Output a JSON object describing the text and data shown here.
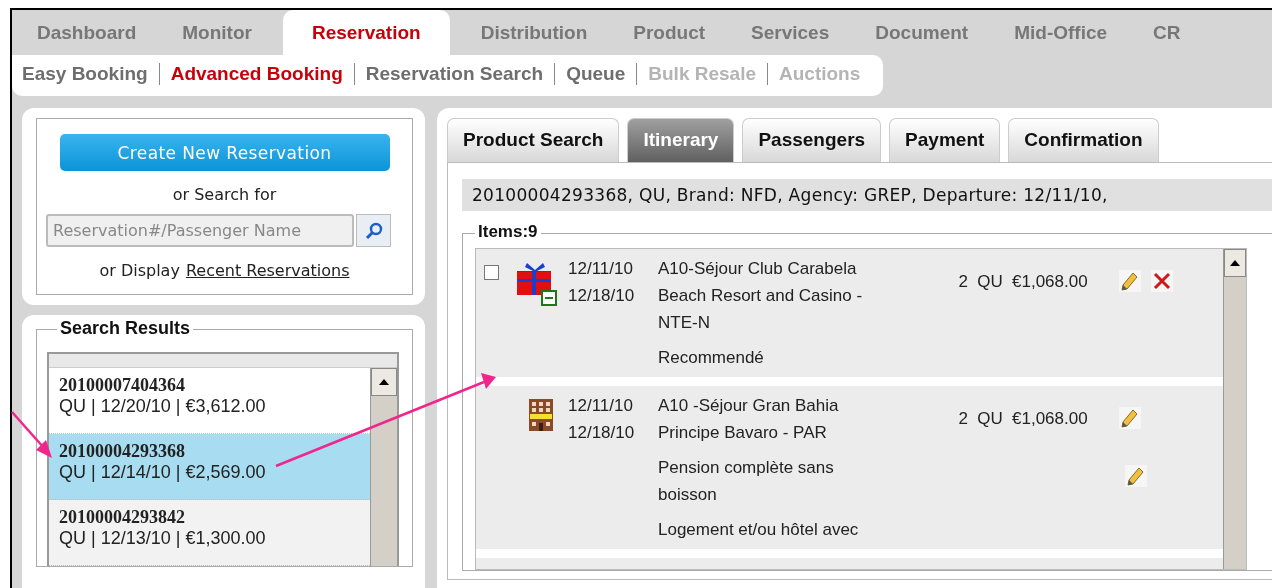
{
  "main_tabs": [
    {
      "label": "Dashboard",
      "selected": false
    },
    {
      "label": "Monitor",
      "selected": false
    },
    {
      "label": "Reservation",
      "selected": true
    },
    {
      "label": "Distribution",
      "selected": false
    },
    {
      "label": "Product",
      "selected": false
    },
    {
      "label": "Services",
      "selected": false
    },
    {
      "label": "Document",
      "selected": false
    },
    {
      "label": "Mid-Office",
      "selected": false
    },
    {
      "label": "CR",
      "selected": false
    }
  ],
  "sub_nav": [
    {
      "label": "Easy Booking",
      "selected": false,
      "disabled": false
    },
    {
      "label": "Advanced Booking",
      "selected": true,
      "disabled": false
    },
    {
      "label": "Reservation Search",
      "selected": false,
      "disabled": false
    },
    {
      "label": "Queue",
      "selected": false,
      "disabled": false
    },
    {
      "label": "Bulk Resale",
      "selected": false,
      "disabled": true
    },
    {
      "label": "Auctions",
      "selected": false,
      "disabled": true
    }
  ],
  "search_panel": {
    "create_button": "Create New Reservation",
    "search_prompt": "or Search for",
    "search_field": {
      "placeholder": "Reservation#/Passenger Name"
    },
    "display_prompt": "or Display",
    "recent_link": "Recent Reservations"
  },
  "search_results": {
    "title": "Search Results",
    "rows": [
      {
        "number": "20100007404364",
        "details": "QU | 12/20/10 | €3,612.00",
        "selected": false
      },
      {
        "number": "20100004293368",
        "details": "QU | 12/14/10 | €2,569.00",
        "selected": true
      },
      {
        "number": "20100004293842",
        "details": "QU | 12/13/10 | €1,300.00",
        "selected": false
      }
    ]
  },
  "booking_tabs": [
    {
      "label": "Product Search",
      "selected": false
    },
    {
      "label": "Itinerary",
      "selected": true
    },
    {
      "label": "Passengers",
      "selected": false
    },
    {
      "label": "Payment",
      "selected": false
    },
    {
      "label": "Confirmation",
      "selected": false
    }
  ],
  "summary": "20100004293368, QU, Brand: NFD, Agency: GREP, Departure: 12/11/10,",
  "items_legend": "Items:9",
  "items": [
    {
      "kind": "package",
      "checked": false,
      "start": "12/11/10",
      "end": "12/18/10",
      "title": "A10-Séjour Club Carabela Beach Resort and Casino - NTE-N",
      "quantity": "2",
      "unit": "QU",
      "price": "€1,068.00",
      "deletable": true,
      "notes": [
        {
          "text": "Recommendé",
          "editable": false
        }
      ]
    },
    {
      "kind": "hotel",
      "start": "12/11/10",
      "end": "12/18/10",
      "title": "A10 -Séjour Gran Bahia Principe Bavaro - PAR",
      "quantity": "2",
      "unit": "QU",
      "price": "€1,068.00",
      "deletable": false,
      "notes": [
        {
          "text": "Pension complète sans boisson",
          "editable": true
        },
        {
          "text": "Logement et/ou hôtel avec",
          "editable": false
        }
      ]
    }
  ]
}
